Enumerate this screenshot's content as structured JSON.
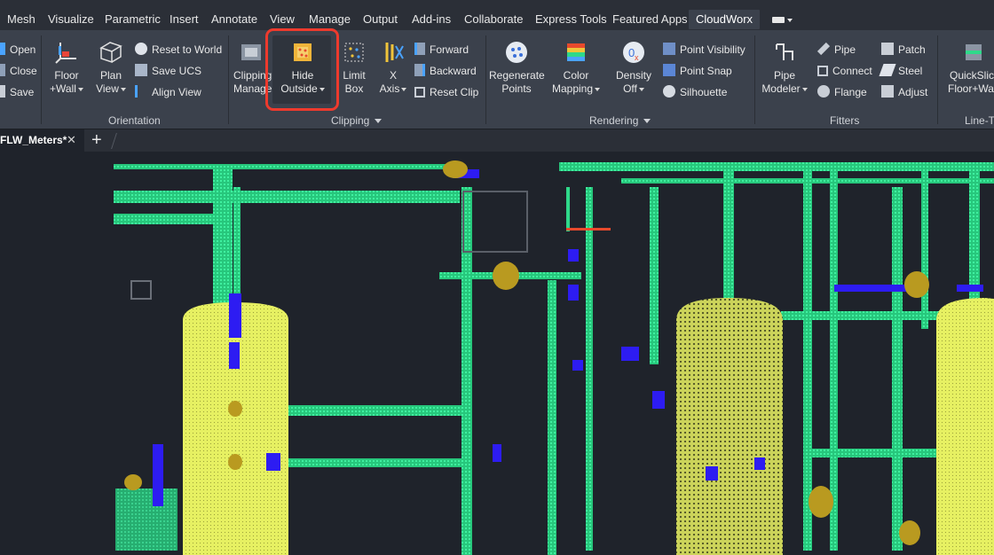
{
  "menu_tabs": [
    {
      "id": "mesh",
      "label": "Mesh"
    },
    {
      "id": "visualize",
      "label": "Visualize"
    },
    {
      "id": "parametric",
      "label": "Parametric"
    },
    {
      "id": "insert",
      "label": "Insert"
    },
    {
      "id": "annotate",
      "label": "Annotate"
    },
    {
      "id": "view",
      "label": "View"
    },
    {
      "id": "manage",
      "label": "Manage"
    },
    {
      "id": "output",
      "label": "Output"
    },
    {
      "id": "addins",
      "label": "Add-ins"
    },
    {
      "id": "collaborate",
      "label": "Collaborate"
    },
    {
      "id": "expresstools",
      "label": "Express Tools"
    },
    {
      "id": "featuredapps",
      "label": "Featured Apps"
    },
    {
      "id": "cloudworx",
      "label": "CloudWorx",
      "active": true
    }
  ],
  "ribbon": {
    "file": {
      "open": "Open",
      "close": "Close",
      "save": "Save"
    },
    "orientation": {
      "label": "Orientation",
      "floor_wall": [
        "Floor",
        "+Wall"
      ],
      "plan_view": [
        "Plan",
        "View"
      ],
      "reset_to_world": "Reset to World",
      "save_ucs": "Save UCS",
      "align_view": "Align View"
    },
    "clipping": {
      "label": "Clipping",
      "clipping_manager": [
        "Clipping",
        "Manager"
      ],
      "hide_outside": [
        "Hide",
        "Outside"
      ],
      "limit_box": [
        "Limit",
        "Box"
      ],
      "x_axis": [
        "X",
        "Axis"
      ],
      "forward": "Forward",
      "backward": "Backward",
      "reset_clip": "Reset Clip"
    },
    "rendering": {
      "label": "Rendering",
      "regenerate_points": [
        "Regenerate",
        "Points"
      ],
      "color_mapping": [
        "Color",
        "Mapping"
      ],
      "density_off": [
        "Density",
        "Off"
      ],
      "point_visibility": "Point Visibility",
      "point_snap": "Point Snap",
      "silhouette": "Silhouette"
    },
    "fitters": {
      "label": "Fitters",
      "pipe_modeler": [
        "Pipe",
        "Modeler"
      ],
      "pipe": "Pipe",
      "connect": "Connect",
      "flange": "Flange",
      "patch": "Patch",
      "steel": "Steel",
      "adjust": "Adjust"
    },
    "line_t": {
      "label": "Line-T",
      "quickslice": [
        "QuickSlice",
        "Floor+Wa"
      ]
    }
  },
  "document": {
    "tab_name": "FLW_Meters*",
    "close_glyph": "✕",
    "new_tab_glyph": "+"
  },
  "colors": {
    "pipe_green": "#2fd98a",
    "tank_yellow": "#eef56a",
    "blue_points": "#2d1cf2",
    "gold_fittings": "#b99a20",
    "highlight_red": "#ee3a2d",
    "viewport_bg": "#1f232b"
  }
}
